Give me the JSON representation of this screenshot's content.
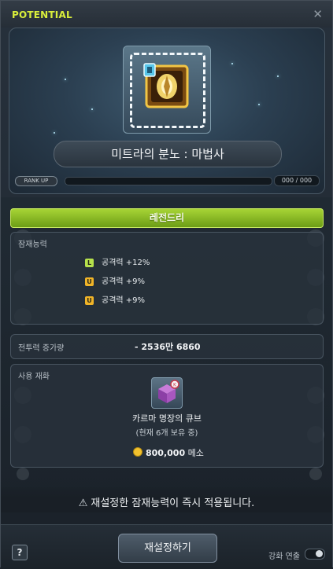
{
  "window": {
    "title": "POTENTIAL",
    "close_icon": "close-icon"
  },
  "item": {
    "name": "미트라의 분노 : 마법사",
    "icon": "emblem-icon"
  },
  "rank": {
    "button_label": "RANK UP",
    "count": "000 / 000"
  },
  "grade": {
    "label": "레전드리",
    "color": "#9ccc2e"
  },
  "potential": {
    "label": "잠재능력",
    "options": [
      {
        "grade": "L",
        "text": "공격력 +12%"
      },
      {
        "grade": "U",
        "text": "공격력 +9%"
      },
      {
        "grade": "U",
        "text": "공격력 +9%"
      }
    ]
  },
  "combat_power": {
    "label": "전투력 증가량",
    "value": "- 2536만 6860"
  },
  "materials": {
    "label": "사용 재화",
    "cube_name": "카르마 명장의 큐브",
    "cube_owned": "(현재 6개 보유 중)",
    "cost_amount": "800,000",
    "cost_unit": "메소"
  },
  "notice": {
    "text": "재설정한 잠재능력이 즉시 적용됩니다."
  },
  "footer": {
    "help_label": "?",
    "reset_label": "재설정하기",
    "enhance_label": "강화 연출"
  },
  "colors": {
    "title": "#d9ee3b",
    "legendary": "#9ccc2e",
    "unique": "#f0b428"
  }
}
